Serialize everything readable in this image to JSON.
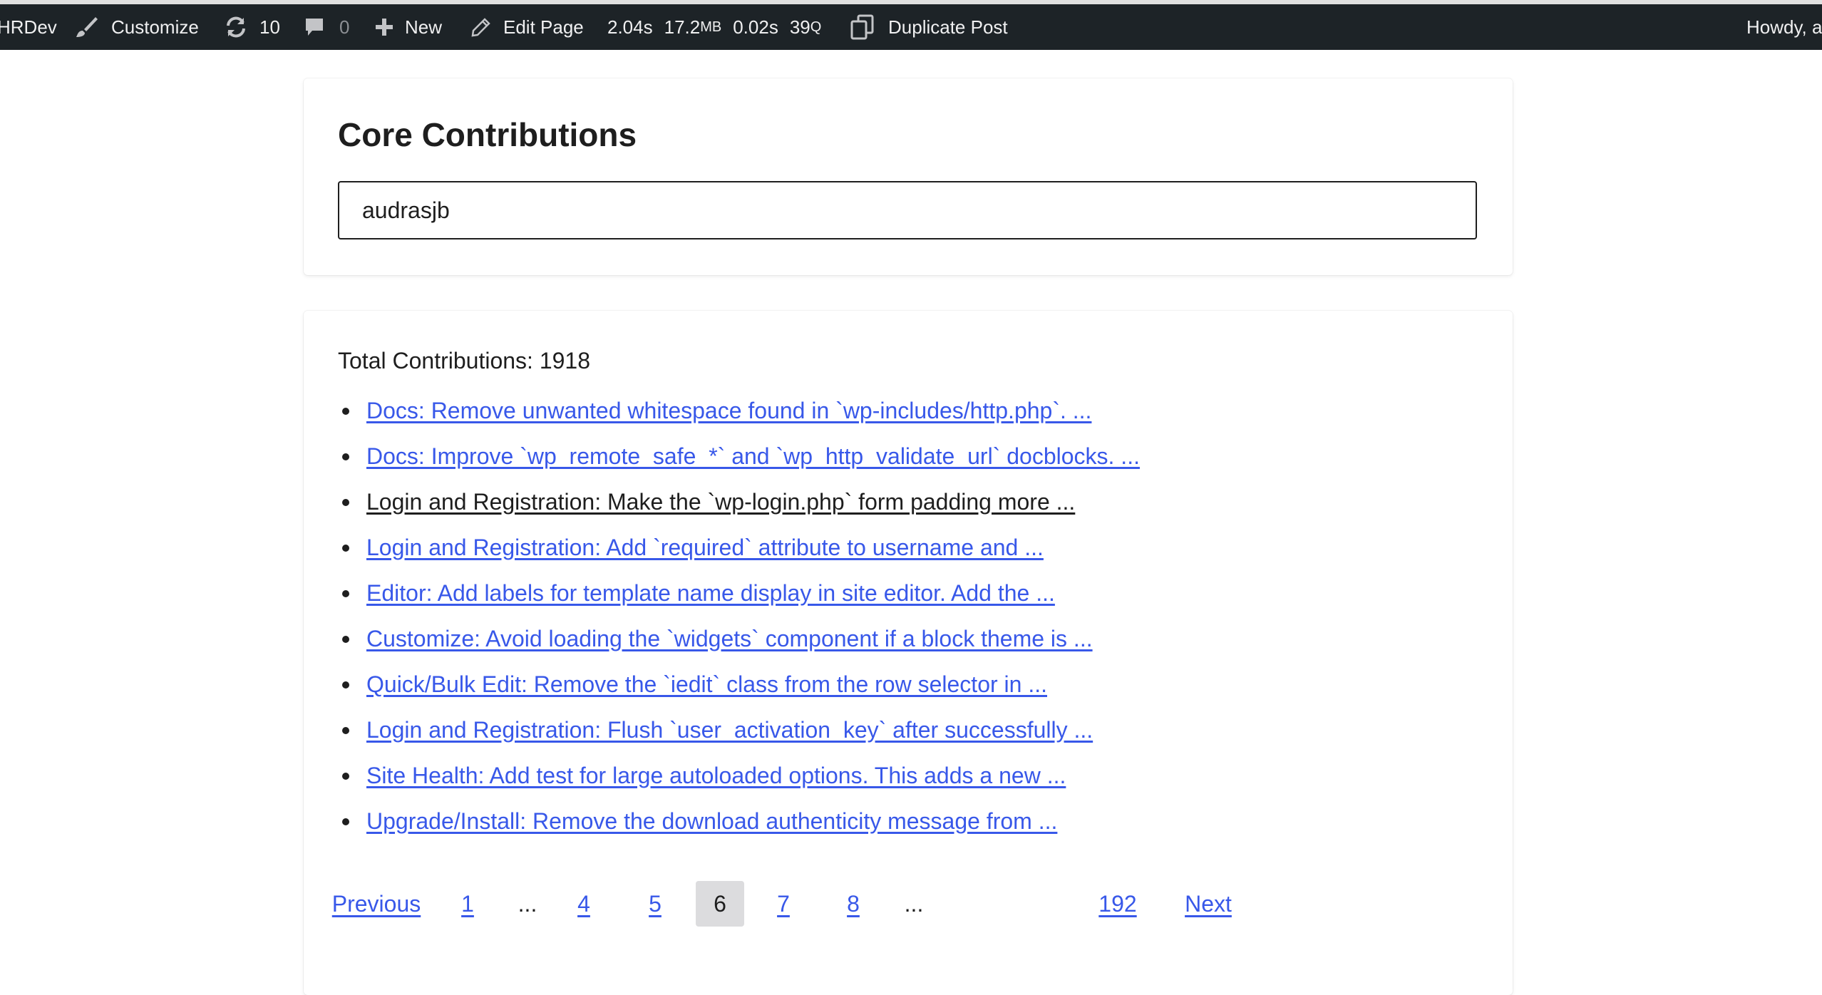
{
  "adminbar": {
    "site_name": "HRDev",
    "customize_label": "Customize",
    "updates_count": "10",
    "comments_count": "0",
    "new_label": "New",
    "edit_label": "Edit Page",
    "qm_time": "2.04s",
    "qm_memory": "17.2",
    "qm_memory_unit": "MB",
    "qm_db_time": "0.02s",
    "qm_queries": "39",
    "qm_queries_unit": "Q",
    "duplicate_label": "Duplicate Post",
    "howdy_label": "Howdy, a"
  },
  "search_card": {
    "title": "Core Contributions",
    "search_value": "audrasjb"
  },
  "results": {
    "total_text": "Total Contributions: 1918",
    "items": [
      {
        "text": "Docs: Remove unwanted whitespace found in `wp-includes/http.php`. ..."
      },
      {
        "text": "Docs: Improve `wp_remote_safe_*` and `wp_http_validate_url` docblocks. ..."
      },
      {
        "text": "Login and Registration: Make the `wp-login.php` form padding more ..."
      },
      {
        "text": "Login and Registration: Add `required` attribute to username and ..."
      },
      {
        "text": "Editor: Add labels for template name display in site editor. Add the ..."
      },
      {
        "text": "Customize: Avoid loading the `widgets` component if a block theme is ..."
      },
      {
        "text": "Quick/Bulk Edit: Remove the `iedit` class from the row selector in ..."
      },
      {
        "text": "Login and Registration: Flush `user_activation_key` after successfully ..."
      },
      {
        "text": "Site Health: Add test for large autoloaded options. This adds a new ..."
      },
      {
        "text": "Upgrade/Install: Remove the download authenticity message from ..."
      }
    ]
  },
  "pagination": {
    "previous": "Previous",
    "page_1": "1",
    "dots_1": "...",
    "page_4": "4",
    "page_5": "5",
    "page_6": "6",
    "page_7": "7",
    "page_8": "8",
    "dots_2": "...",
    "page_last": "192",
    "next": "Next"
  },
  "colors": {
    "adminbar_bg": "#1d2327",
    "link": "#3858e9",
    "text": "#1e1e1e",
    "current_page_bg": "#dcdcde"
  }
}
